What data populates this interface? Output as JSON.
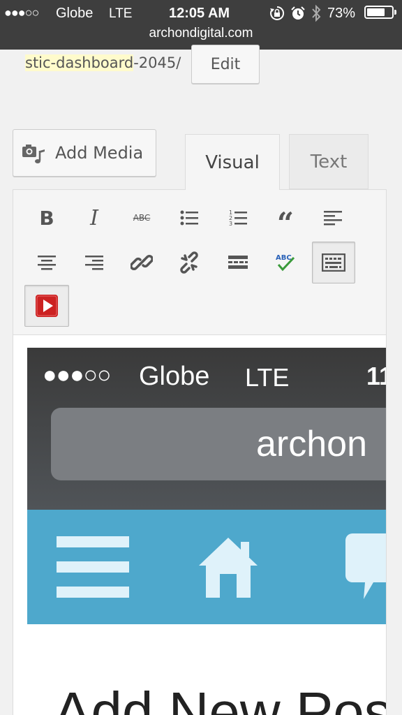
{
  "status_bar": {
    "signal": "●●●○○",
    "carrier": "Globe",
    "network": "LTE",
    "time": "12:05 AM",
    "battery_percent": "73%",
    "battery_level": 0.73,
    "url": "archondigital.com"
  },
  "permalink": {
    "slug_highlight": "stic-dashboard",
    "slug_rest": "-2045/",
    "edit_label": "Edit"
  },
  "editor": {
    "add_media_label": "Add Media",
    "tabs": [
      "Visual",
      "Text"
    ],
    "toolbar_icons": [
      "bold-icon",
      "italic-icon",
      "strikethrough-icon",
      "bullet-list-icon",
      "numbered-list-icon",
      "blockquote-icon",
      "align-left-icon",
      "align-center-icon",
      "align-right-icon",
      "insert-link-icon",
      "unlink-icon",
      "read-more-icon",
      "spellcheck-icon",
      "toolbar-toggle-icon",
      "youtube-embed-icon"
    ],
    "embedded_screenshot": {
      "signal": "●●●○○",
      "carrier": "Globe",
      "network": "LTE",
      "time_partial": "11",
      "url_partial": "archon",
      "heading_partial": "Add New Pos"
    }
  },
  "colors": {
    "status_bar": "#3e3e3e",
    "nav_blue": "#4ea8cc",
    "highlight": "#fffbcc",
    "youtube_red": "#cc2222",
    "spellcheck_green": "#3a9a3a",
    "spellcheck_blue": "#2a62b8"
  }
}
